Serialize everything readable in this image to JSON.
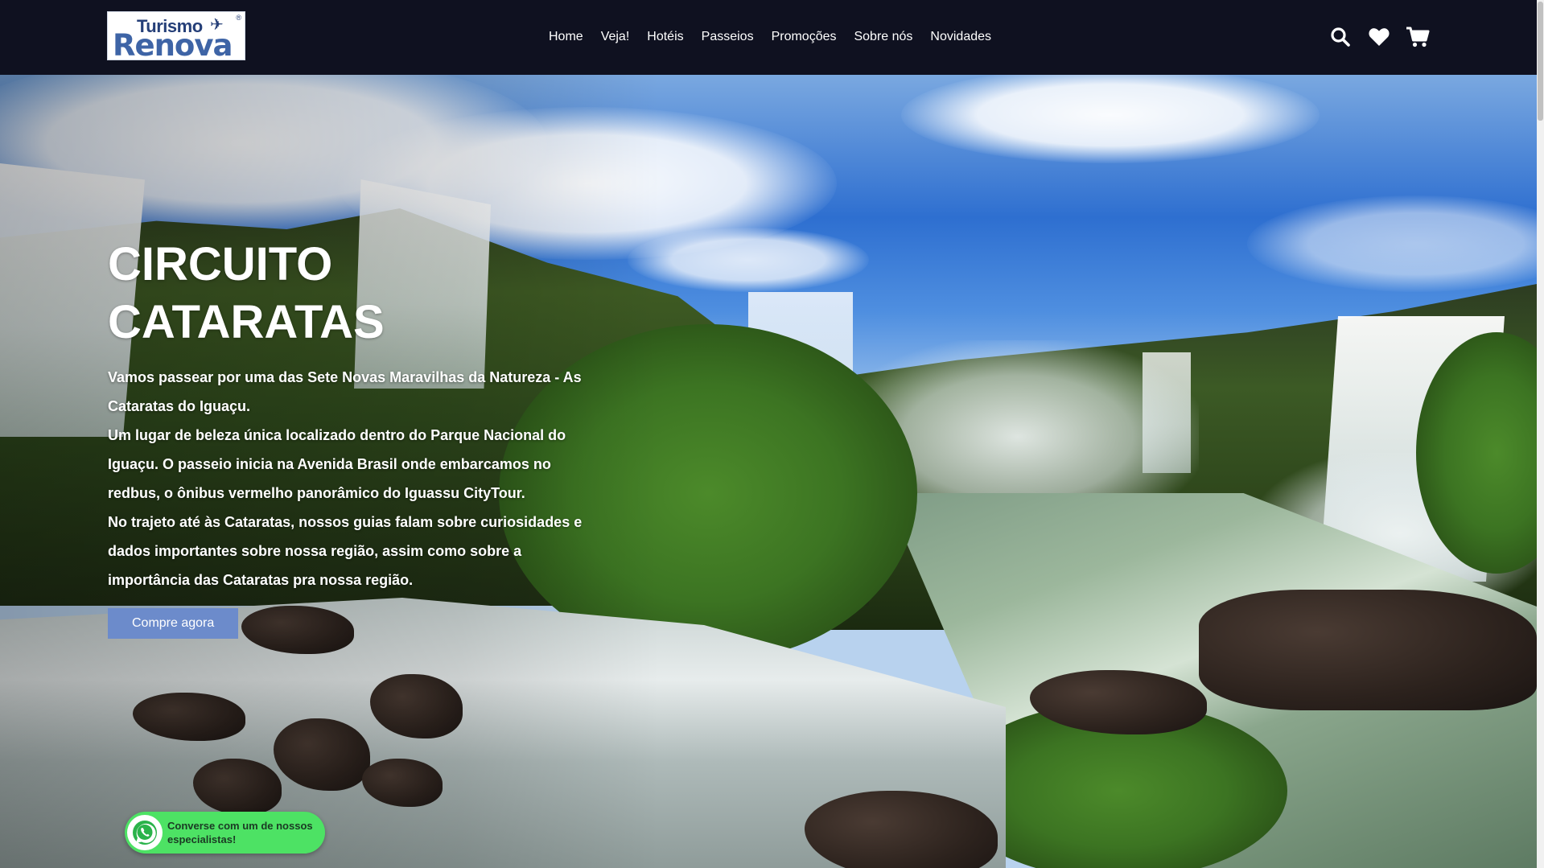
{
  "brand": {
    "logo_line1": "Turismo",
    "logo_line2": "Renova",
    "logo_reg": "®"
  },
  "nav": {
    "items": [
      {
        "label": "Home"
      },
      {
        "label": "Veja!"
      },
      {
        "label": "Hotéis"
      },
      {
        "label": "Passeios"
      },
      {
        "label": "Promoções"
      },
      {
        "label": "Sobre nós"
      },
      {
        "label": "Novidades"
      }
    ]
  },
  "header_icons": [
    "search-icon",
    "heart-icon",
    "cart-icon"
  ],
  "hero": {
    "title_line1": "CIRCUITO",
    "title_line2": "CATARATAS",
    "paragraphs": [
      "Vamos passear por uma das Sete Novas Maravilhas da Natureza - As Cataratas do Iguaçu.",
      "Um lugar de beleza única localizado dentro do Parque Nacional do Iguaçu. O passeio inicia na Avenida Brasil onde embarcamos no redbus, o ônibus vermelho panorâmico do Iguassu CityTour.",
      "No trajeto até às Cataratas, nossos guias falam sobre curiosidades e dados importantes sobre nossa região, assim como sobre a importância das Cataratas pra nossa região."
    ],
    "cta_label": "Compre agora"
  },
  "whatsapp": {
    "text": "Converse com um de nossos especialistas!"
  },
  "colors": {
    "header_bg": "#0f1120",
    "cta_bg": "#6c8bcb",
    "whatsapp_bg": "#4de264",
    "logo_blue": "#3e64a6"
  }
}
